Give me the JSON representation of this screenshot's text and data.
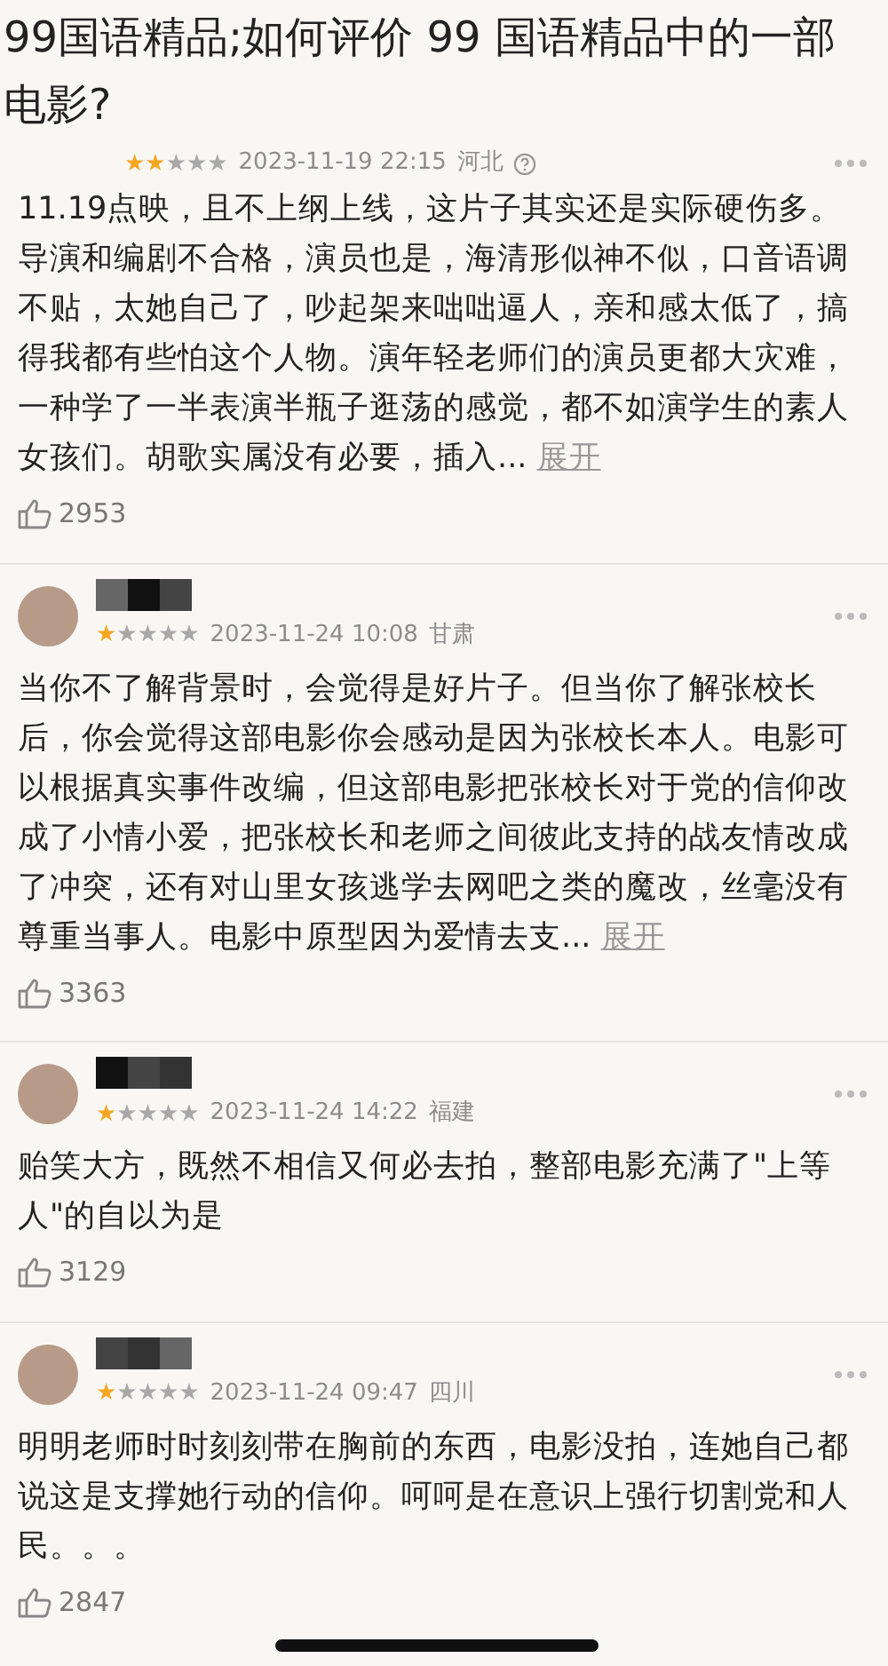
{
  "title": "99国语精品;如何评价 99 国语精品中的一部电影?",
  "reviews": [
    {
      "stars": 2,
      "date": "2023-11-19 22:15",
      "region": "河北",
      "info_mark": true,
      "text": "11.19点映，且不上纲上线，这片子其实还是实际硬伤多。导演和编剧不合格，演员也是，海清形似神不似，口音语调不贴，太她自己了，吵起架来咄咄逼人，亲和感太低了，搞得我都有些怕这个人物。演年轻老师们的演员更都大灾难，一种学了一半表演半瓶子逛荡的感觉，都不如演学生的素人女孩们。胡歌实属没有必要，插入...",
      "more": "展开",
      "likes": "2953"
    },
    {
      "stars": 1,
      "date": "2023-11-24 10:08",
      "region": "甘肃",
      "text": "当你不了解背景时，会觉得是好片子。但当你了解张校长后，你会觉得这部电影你会感动是因为张校长本人。电影可以根据真实事件改编，但这部电影把张校长对于党的信仰改成了小情小爱，把张校长和老师之间彼此支持的战友情改成了冲突，还有对山里女孩逃学去网吧之类的魔改，丝毫没有尊重当事人。电影中原型因为爱情去支...",
      "more": "展开",
      "likes": "3363"
    },
    {
      "stars": 1,
      "date": "2023-11-24 14:22",
      "region": "福建",
      "text": "贻笑大方，既然不相信又何必去拍，整部电影充满了\"上等人\"的自以为是",
      "likes": "3129"
    },
    {
      "stars": 1,
      "date": "2023-11-24 09:47",
      "region": "四川",
      "text": "明明老师时时刻刻带在胸前的东西，电影没拍，连她自己都说这是支撑她行动的信仰。呵呵是在意识上强行切割党和人民。。。",
      "likes": "2847"
    }
  ]
}
